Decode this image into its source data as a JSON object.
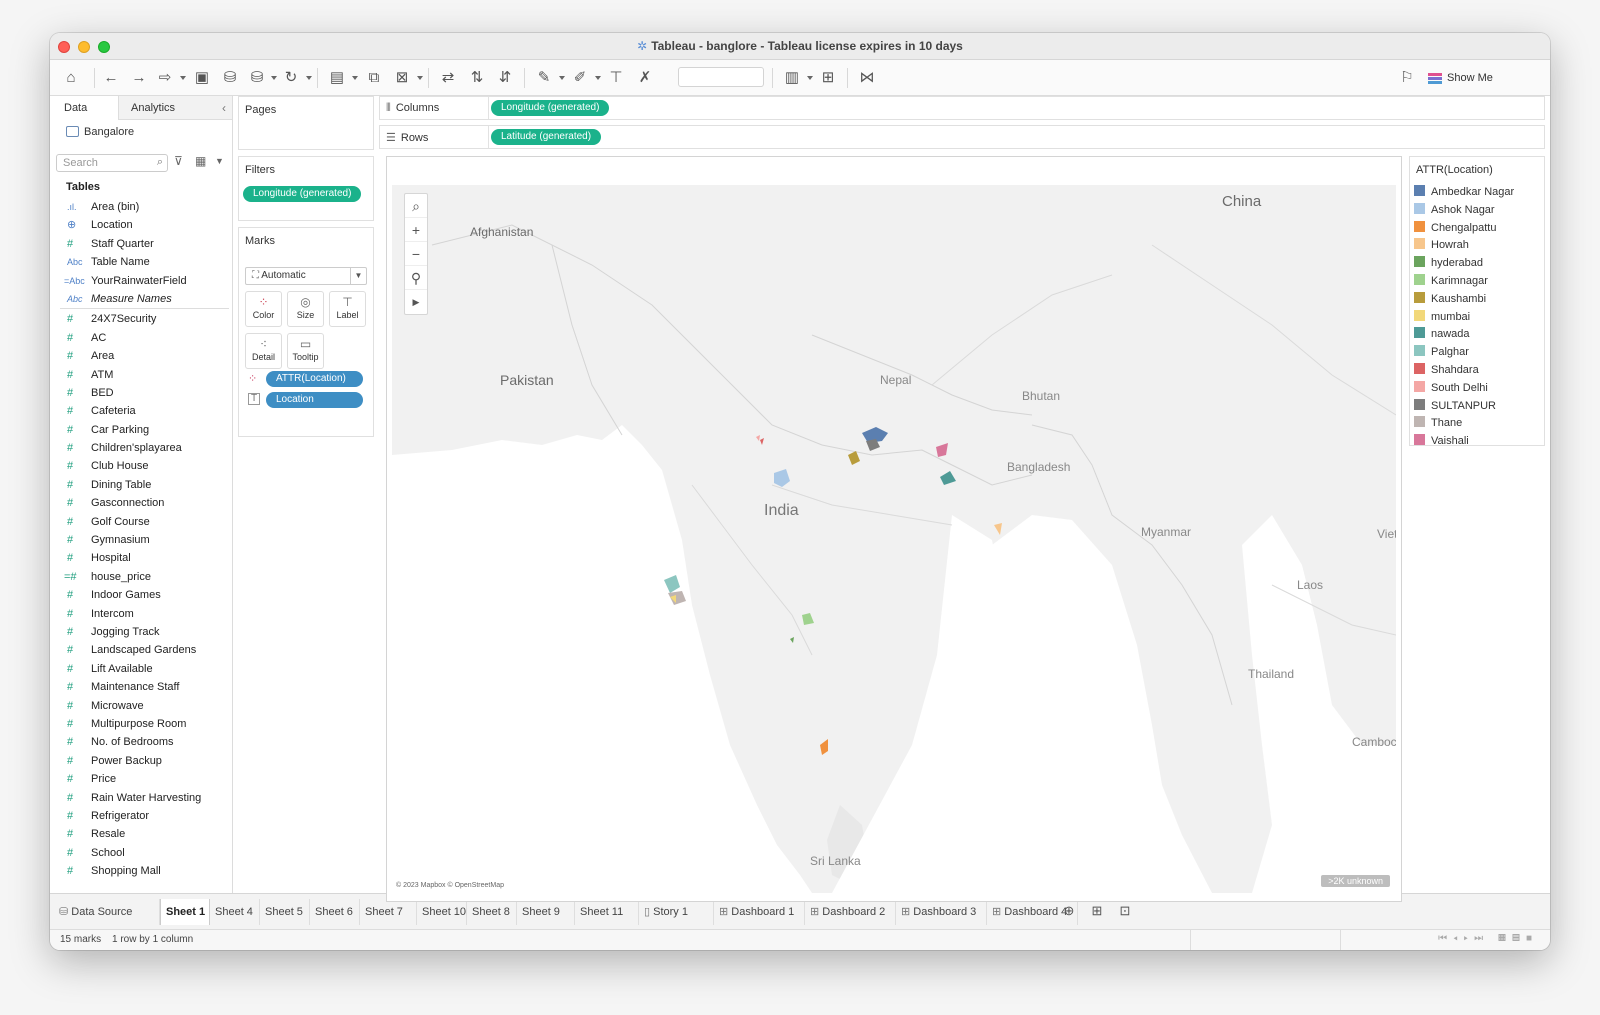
{
  "window": {
    "title": "Tableau - banglore - Tableau license expires in 10 days"
  },
  "toolbar": {
    "show_me": "Show Me"
  },
  "data_pane": {
    "tabs": [
      "Data",
      "Analytics"
    ],
    "datasource": "Bangalore",
    "search_placeholder": "Search",
    "tables_heading": "Tables",
    "fields_top": [
      {
        "icon": "bar-icon",
        "name": "Area (bin)"
      },
      {
        "icon": "globe-icon",
        "name": "Location"
      },
      {
        "icon": "hash-icon",
        "name": "Staff Quarter"
      },
      {
        "icon": "abc-icon",
        "name": "Table Name"
      },
      {
        "icon": "calc-abc-icon",
        "name": "YourRainwaterField"
      },
      {
        "icon": "abc-icon",
        "name": "Measure Names"
      }
    ],
    "fields_measures": [
      "24X7Security",
      "AC",
      "Area",
      "ATM",
      "BED",
      "Cafeteria",
      "Car Parking",
      "Children'splayarea",
      "Club House",
      "Dining Table",
      "Gasconnection",
      "Golf Course",
      "Gymnasium",
      "Hospital",
      "house_price",
      "Indoor Games",
      "Intercom",
      "Jogging Track",
      "Landscaped Gardens",
      "Lift Available",
      "Maintenance Staff",
      "Microwave",
      "Multipurpose Room",
      "No. of Bedrooms",
      "Power Backup",
      "Price",
      "Rain Water Harvesting",
      "Refrigerator",
      "Resale",
      "School",
      "Shopping Mall"
    ]
  },
  "pages": {
    "label": "Pages"
  },
  "filters": {
    "label": "Filters",
    "pills": [
      "Longitude (generated)"
    ]
  },
  "marks": {
    "label": "Marks",
    "type": "Automatic",
    "buttons": [
      "Color",
      "Size",
      "Label",
      "Detail",
      "Tooltip"
    ],
    "pills": [
      "ATTR(Location)",
      "Location"
    ]
  },
  "columns": {
    "label": "Columns",
    "pill": "Longitude (generated)"
  },
  "rows": {
    "label": "Rows",
    "pill": "Latitude (generated)"
  },
  "map": {
    "labels": [
      "China",
      "Afghanistan",
      "Pakistan",
      "Nepal",
      "Bhutan",
      "Bangladesh",
      "India",
      "Myanmar",
      "Viet",
      "Laos",
      "Thailand",
      "Camboc",
      "Sri Lanka"
    ],
    "credit": "© 2023 Mapbox © OpenStreetMap",
    "unknown_badge": ">2K unknown"
  },
  "legend": {
    "title": "ATTR(Location)",
    "items": [
      {
        "label": "Ambedkar Nagar",
        "color": "#5b7fb0"
      },
      {
        "label": "Ashok Nagar",
        "color": "#aac8e6"
      },
      {
        "label": "Chengalpattu",
        "color": "#f0913e"
      },
      {
        "label": "Howrah",
        "color": "#f7c68c"
      },
      {
        "label": "hyderabad",
        "color": "#6ba45e"
      },
      {
        "label": "Karimnagar",
        "color": "#9fd28e"
      },
      {
        "label": "Kaushambi",
        "color": "#b89c3c"
      },
      {
        "label": "mumbai",
        "color": "#f2d87a"
      },
      {
        "label": "nawada",
        "color": "#4e9a96"
      },
      {
        "label": "Palghar",
        "color": "#8cc6c0"
      },
      {
        "label": "Shahdara",
        "color": "#dc6464"
      },
      {
        "label": "South Delhi",
        "color": "#f4a7a5"
      },
      {
        "label": "SULTANPUR",
        "color": "#7d7d7d"
      },
      {
        "label": "Thane",
        "color": "#bfb5b2"
      },
      {
        "label": "Vaishali",
        "color": "#d8779a"
      }
    ]
  },
  "sheet_tabs": [
    {
      "label": "Data Source",
      "icon": "datasource-icon",
      "active": false
    },
    {
      "label": "Sheet 1",
      "active": true
    },
    {
      "label": "Sheet 4"
    },
    {
      "label": "Sheet 5"
    },
    {
      "label": "Sheet 6"
    },
    {
      "label": "Sheet 7"
    },
    {
      "label": "Sheet 10"
    },
    {
      "label": "Sheet 8"
    },
    {
      "label": "Sheet 9"
    },
    {
      "label": "Sheet 11"
    },
    {
      "label": "Story 1",
      "icon": "story-icon"
    },
    {
      "label": "Dashboard 1",
      "icon": "dashboard-icon"
    },
    {
      "label": "Dashboard 2",
      "icon": "dashboard-icon"
    },
    {
      "label": "Dashboard 3",
      "icon": "dashboard-icon"
    },
    {
      "label": "Dashboard 4",
      "icon": "dashboard-icon"
    }
  ],
  "status": {
    "marks": "15 marks",
    "layout": "1 row by 1 column"
  }
}
